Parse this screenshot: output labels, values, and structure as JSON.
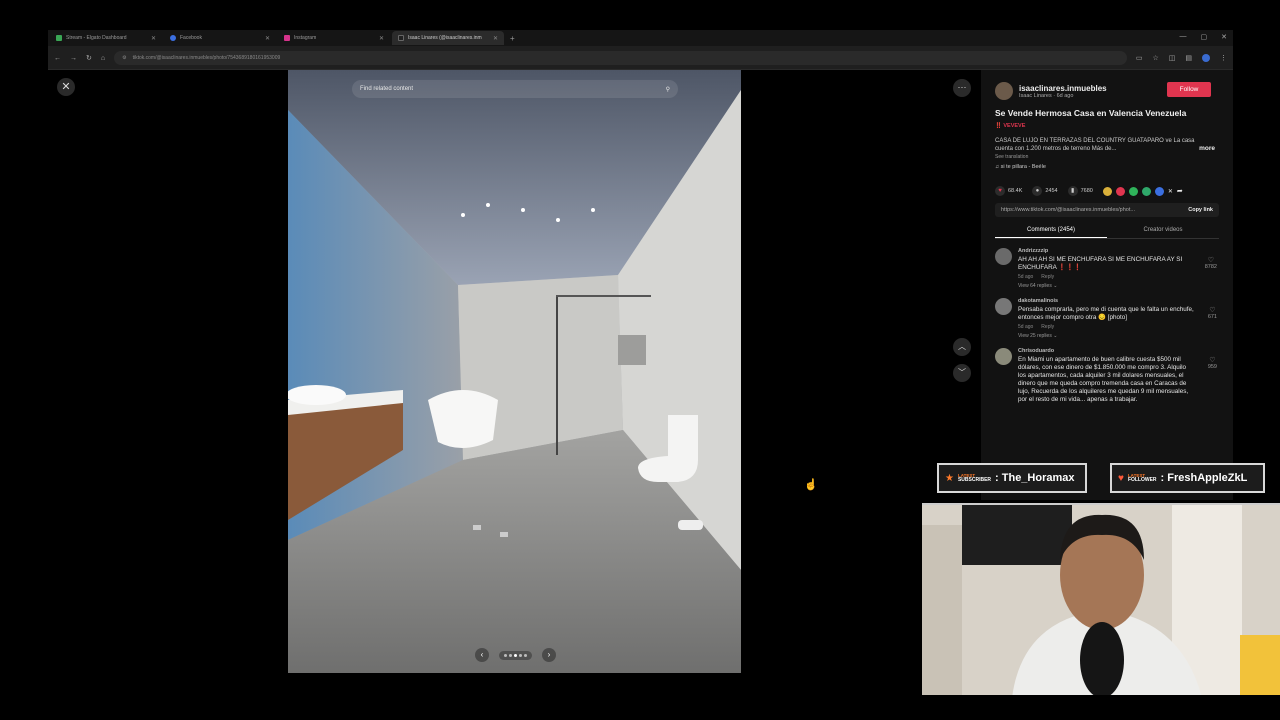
{
  "browser": {
    "tabs": [
      {
        "label": "Stream - Elgato Dashboard",
        "favicon_color": "#3aa655"
      },
      {
        "label": "Facebook",
        "favicon_color": "#3b6fe0"
      },
      {
        "label": "Instagram",
        "favicon_color": "#d6338b"
      },
      {
        "label": "Isaac Linares (@isaaclinares.inm",
        "favicon_color": "#222222"
      }
    ],
    "new_tab": "+",
    "url": "tiktok.com/@isaaclinares.inmuebles/photo/7543689180161953009",
    "window_controls": [
      "—",
      "▢",
      "✕"
    ]
  },
  "viewer": {
    "close": "✕",
    "search_placeholder": "Find related content",
    "more": "···",
    "prev": "‹",
    "next": "›",
    "up": "︿",
    "down": "﹀",
    "slide_count": 5,
    "slide_active": 1
  },
  "post": {
    "author_handle": "isaaclinares.inmuebles",
    "author_sub": "Isaac Linares · 6d ago",
    "follow_label": "Follow",
    "title": "Se Vende Hermosa Casa en Valencia Venezuela",
    "title_tag": "‼️ VEVEVE",
    "description": "CASA DE LUJO EN TERRAZAS DEL COUNTRY GUATAPARO ve La casa cuenta con 1.200 metros de terreno Más de...",
    "more_label": "more",
    "see_translation": "See translation",
    "music": "♫ si te pillara - Beéle",
    "likes": "68.4K",
    "comments": "2454",
    "saves": "7680",
    "link": "https://www.tiktok.com/@isaaclinares.inmuebles/phot...",
    "copy_link": "Copy link",
    "tab_comments": "Comments (2454)",
    "tab_creator": "Creator videos"
  },
  "comments": [
    {
      "user": "Andrizzzzip",
      "text": "AH AH AH SI ME ENCHUFARA SI ME ENCHUFARA AY SI ENCHUFARA ❗❗❗",
      "date": "5d ago",
      "reply": "Reply",
      "replies": "View 64 replies ⌄",
      "likes": "8782"
    },
    {
      "user": "dakotamalinois",
      "text": "Pensaba comprarla, pero me di cuenta que le falta un enchufe, entonces mejor compro otra 😔 [photo]",
      "date": "5d ago",
      "reply": "Reply",
      "replies": "View 25 replies ⌄",
      "likes": "671"
    },
    {
      "user": "Chrisoduardo",
      "text": "En Miami un apartamento de buen calibre cuesta $500 mil dólares, con ese dinero de $1.850.000 me compro 3. Alquilo los apartamentos, cada alquiler 3 mil dolares mensuales, el dinero que me queda compro tremenda casa en Caracas de lujo, Recuerda de los alquileres me quedan 9 mil mensuales, por el resto de mi vida... apenas a trabajar.",
      "date": "",
      "reply": "",
      "replies": "",
      "likes": "959"
    }
  ],
  "overlay": {
    "sub_tag_top": "LATEST",
    "sub_tag": "SUBSCRIBER",
    "sub_name": ": The_Horamax",
    "fol_tag_top": "LATEST",
    "fol_tag": "FOLLOWER",
    "fol_name": ": FreshAppleZkL"
  },
  "colors": {
    "follow": "#e0354f",
    "accent_orange": "#ff7a2a"
  }
}
